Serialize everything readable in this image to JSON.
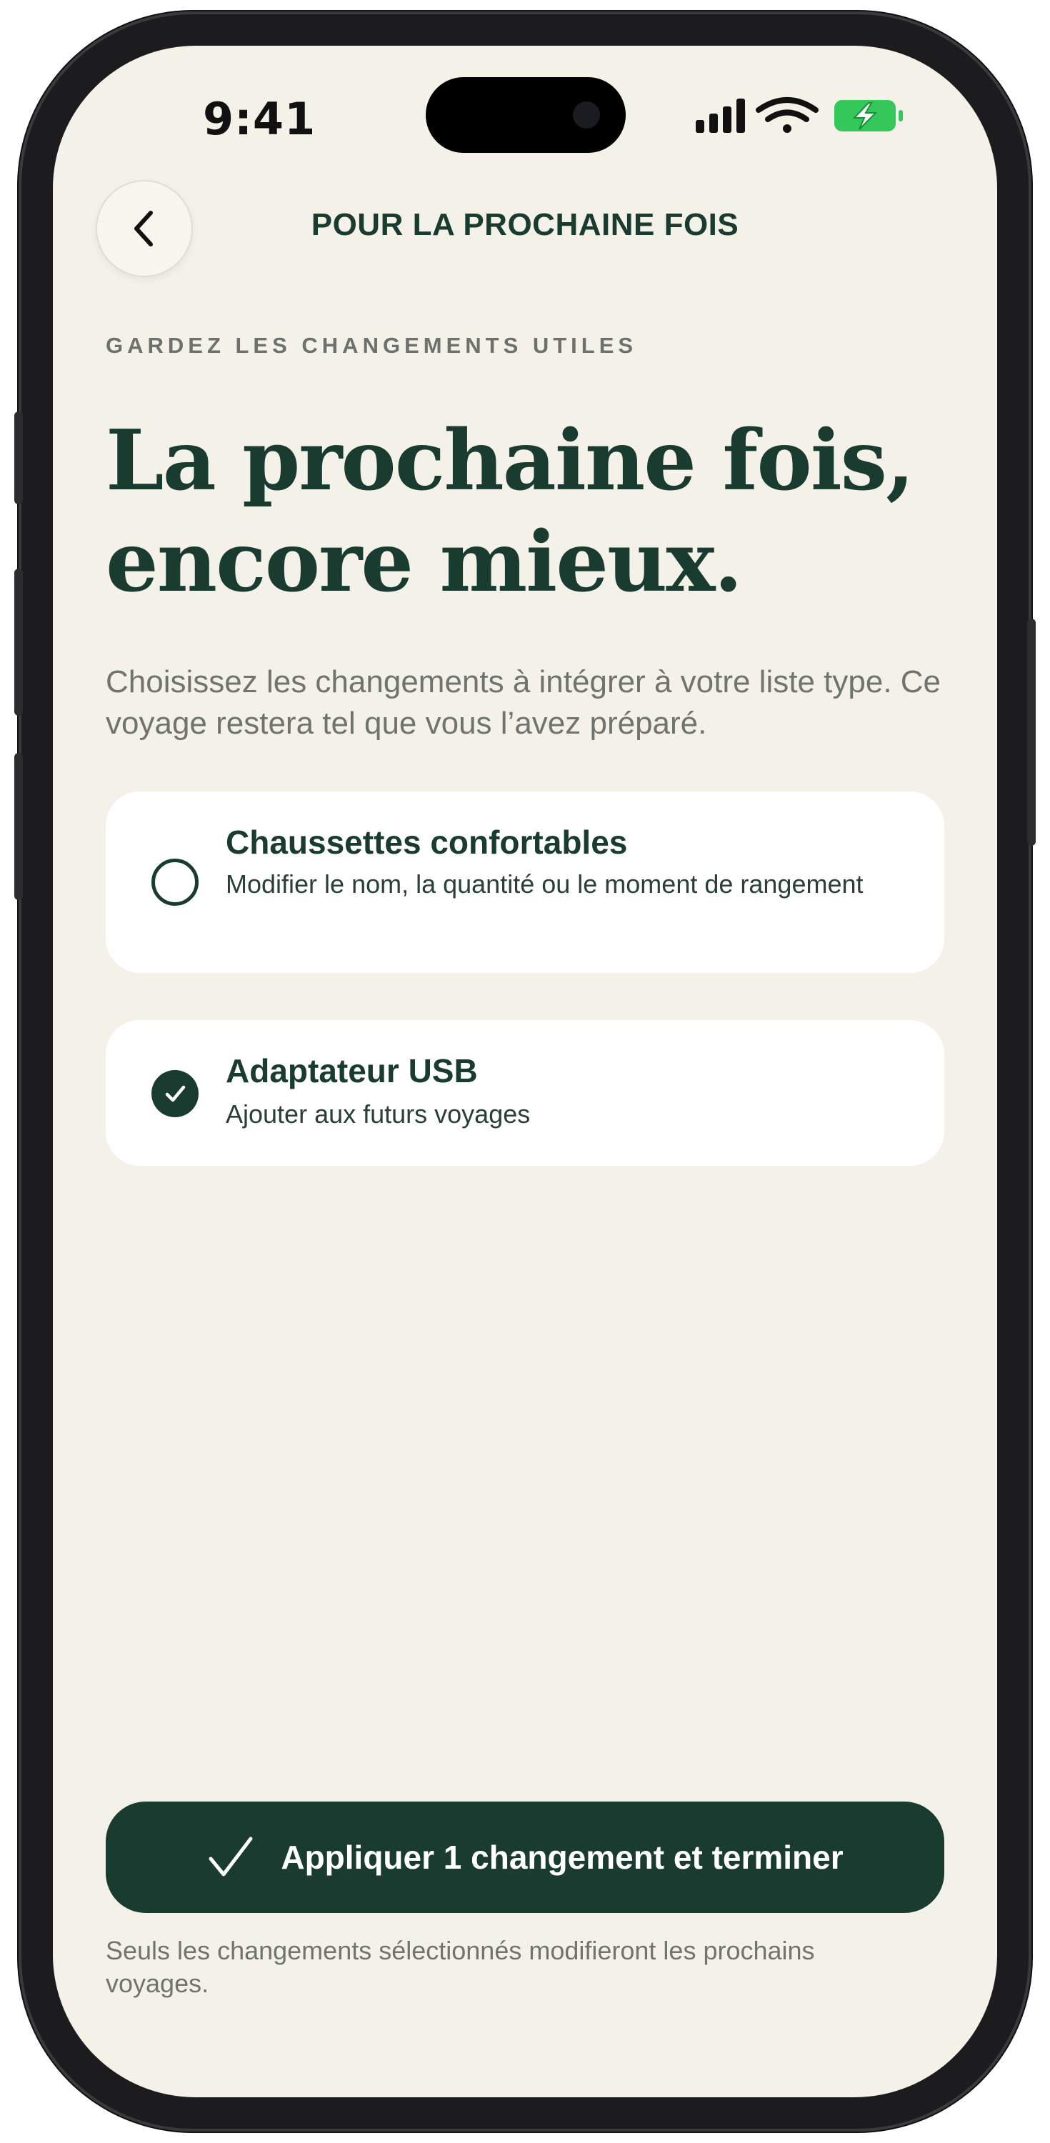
{
  "status_bar": {
    "time": "9:41",
    "icons": [
      "cellular-signal-icon",
      "wifi-icon",
      "battery-charging-icon"
    ],
    "battery_color": "#34c759"
  },
  "header": {
    "back_icon": "chevron-left-icon",
    "title": "POUR LA PROCHAINE FOIS"
  },
  "content": {
    "eyebrow": "GARDEZ LES CHANGEMENTS UTILES",
    "headline_line1": "La prochaine fois,",
    "headline_line2": "encore mieux.",
    "lead": "Choisissez les changements à intégrer à votre liste type. Ce voyage restera tel que vous l’avez préparé."
  },
  "changes": [
    {
      "title": "Chaussettes confortables",
      "subtitle": "Modifier le nom, la quantité ou le moment de rangement",
      "selected": false
    },
    {
      "title": "Adaptateur USB",
      "subtitle": "Ajouter aux futurs voyages",
      "selected": true
    }
  ],
  "footer": {
    "apply_icon": "checkmark-icon",
    "apply_label": "Appliquer 1 changement et terminer",
    "note": "Seuls les changements sélectionnés modifieront les prochains voyages."
  },
  "colors": {
    "accent": "#1a3b30",
    "background": "#f4f1e9",
    "card": "#ffffff",
    "muted_text": "#6f746f"
  }
}
